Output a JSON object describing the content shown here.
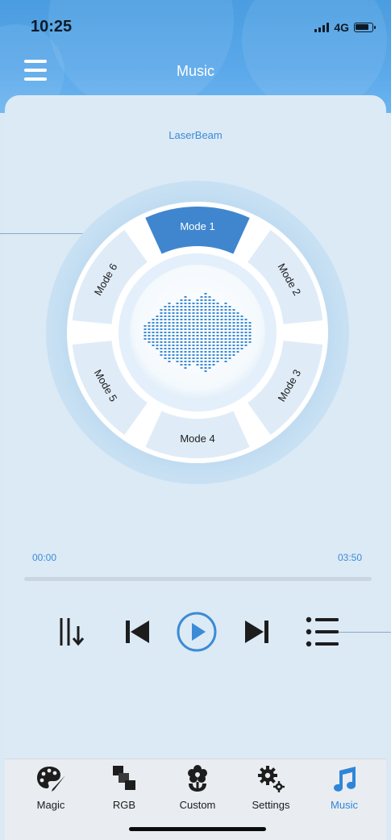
{
  "status": {
    "time": "10:25",
    "network": "4G"
  },
  "header": {
    "title": "Music"
  },
  "device": {
    "name": "LaserBeam"
  },
  "modes": [
    {
      "id": 1,
      "label": "Mode 1",
      "selected": true
    },
    {
      "id": 2,
      "label": "Mode 2",
      "selected": false
    },
    {
      "id": 3,
      "label": "Mode 3",
      "selected": false
    },
    {
      "id": 4,
      "label": "Mode 4",
      "selected": false
    },
    {
      "id": 5,
      "label": "Mode 5",
      "selected": false
    },
    {
      "id": 6,
      "label": "Mode 6",
      "selected": false
    }
  ],
  "player": {
    "elapsed": "00:00",
    "total": "03:50",
    "progress": 0
  },
  "controls": [
    "sort-down-icon",
    "previous-track-icon",
    "play-icon",
    "next-track-icon",
    "playlist-icon"
  ],
  "tabs": [
    {
      "label": "Magic",
      "icon": "palette-icon",
      "active": false
    },
    {
      "label": "RGB",
      "icon": "rgb-blocks-icon",
      "active": false
    },
    {
      "label": "Custom",
      "icon": "flower-icon",
      "active": false
    },
    {
      "label": "Settings",
      "icon": "gears-icon",
      "active": false
    },
    {
      "label": "Music",
      "icon": "music-note-icon",
      "active": true
    }
  ],
  "colors": {
    "accent": "#3c8bd6",
    "header": "#4a9de0",
    "panel": "#dceaf6",
    "selected_mode": "#3f86cf"
  }
}
